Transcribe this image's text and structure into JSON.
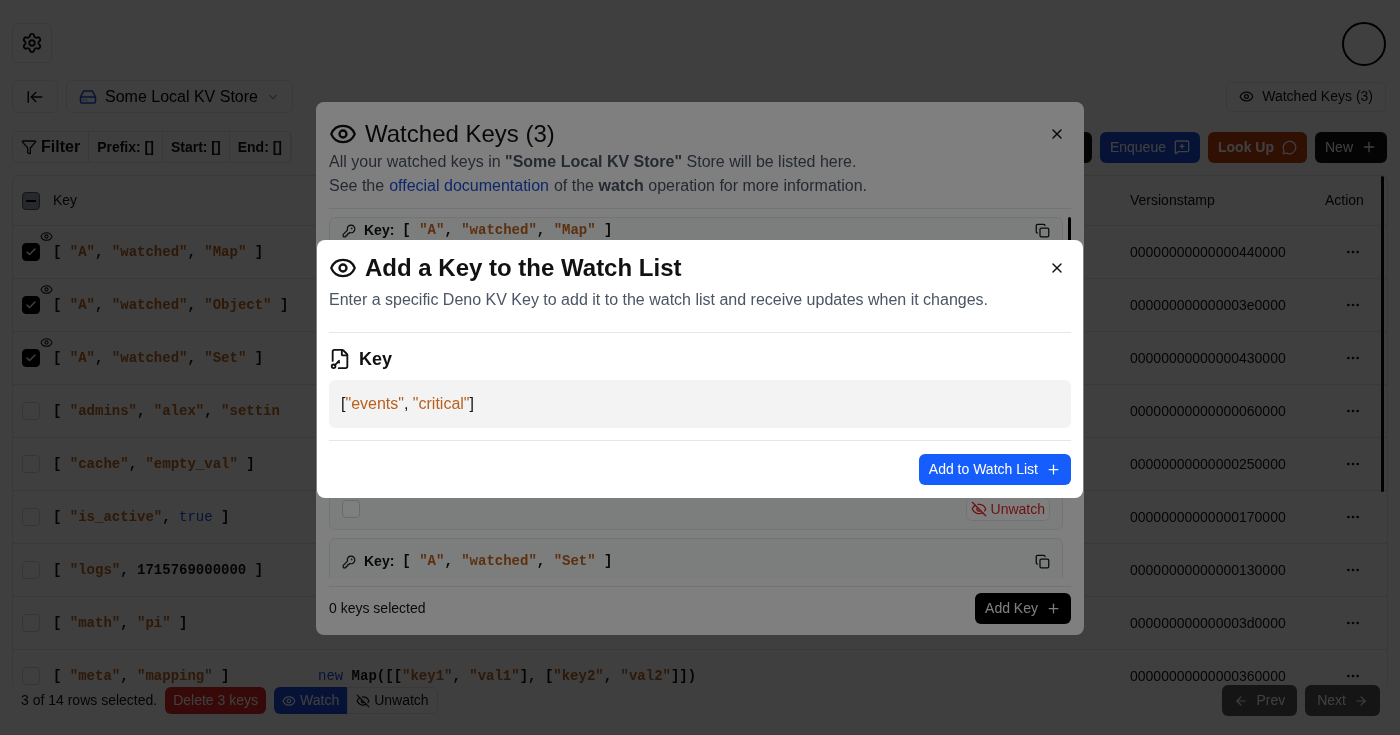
{
  "store_select": {
    "value": "Some Local KV Store"
  },
  "watched_keys_button": {
    "label": "Watched Keys (3)"
  },
  "filter": {
    "label": "Filter",
    "chips": [
      "Prefix: []",
      "Start: []",
      "End: []"
    ]
  },
  "actions": [
    {
      "kind": "icon"
    },
    {
      "kind": "blue",
      "label": "Enqueue"
    },
    {
      "kind": "orange",
      "label": "Look Up"
    },
    {
      "kind": "dark",
      "label": "New"
    }
  ],
  "table": {
    "header_indeterminate": true,
    "columns": {
      "key": "Key",
      "versionstamp": "Versionstamp",
      "action": "Action"
    },
    "rows": [
      {
        "checked": true,
        "watched": true,
        "key": "[ \"A\", \"watched\", \"Map\" ]",
        "versionstamp": "00000000000000440000"
      },
      {
        "checked": true,
        "watched": true,
        "key": "[ \"A\", \"watched\", \"Object\" ]",
        "versionstamp": "000000000000003e0000"
      },
      {
        "checked": true,
        "watched": true,
        "key": "[ \"A\", \"watched\", \"Set\" ]",
        "versionstamp": "00000000000000430000"
      },
      {
        "checked": false,
        "watched": false,
        "key": "[ \"admins\", \"alex\", \"settin",
        "versionstamp": "00000000000000060000"
      },
      {
        "checked": false,
        "watched": false,
        "key": "[ \"cache\", \"empty_val\" ]",
        "versionstamp": "00000000000000250000"
      },
      {
        "checked": false,
        "watched": false,
        "key": "[ \"is_active\", true ]",
        "versionstamp": "00000000000000170000"
      },
      {
        "checked": false,
        "watched": false,
        "key": "[ \"logs\", 1715769000000 ]",
        "versionstamp": "00000000000000130000"
      },
      {
        "checked": false,
        "watched": false,
        "key": "[ \"math\", \"pi\" ]",
        "versionstamp": "000000000000003d0000"
      },
      {
        "checked": false,
        "watched": false,
        "key": "[ \"meta\", \"mapping\" ]",
        "value": "new Map([[\"key1\", \"val1\"], [\"key2\", \"val2\"]])",
        "versionstamp": "00000000000000360000"
      }
    ]
  },
  "footer": {
    "selection": "3 of 14 rows selected.",
    "delete": "Delete 3 keys",
    "watch": "Watch",
    "unwatch": "Unwatch",
    "prev": {
      "label": "Prev",
      "disabled": true
    },
    "next": {
      "label": "Next",
      "disabled": true
    }
  },
  "watched_modal": {
    "title": "Watched Keys (3)",
    "description": "All your watched keys in **\"Some Local KV Store\"** Store will be listed here.",
    "doc_before": "See the",
    "doc_link": "offecial documentation",
    "doc_after": "of the **watch** operation for more information.",
    "cards": [
      {
        "key_label": "Key:",
        "key": "[ \"A\", \"watched\", \"Map\" ]"
      },
      {
        "checked": false,
        "unwatch": "Unwatch"
      },
      {
        "key_label": "Key:",
        "key": "[ \"A\", \"watched\", \"Set\" ]"
      }
    ],
    "selected_count": "0 keys selected",
    "add_button": "Add Key"
  },
  "add_modal": {
    "title": "Add a Key to the Watch List",
    "description": "Enter a specific Deno KV Key to add it to the watch list and receive updates when it changes.",
    "field_label": "Key",
    "value": "[\"events\", \"critical\"]",
    "submit": "Add to Watch List"
  }
}
